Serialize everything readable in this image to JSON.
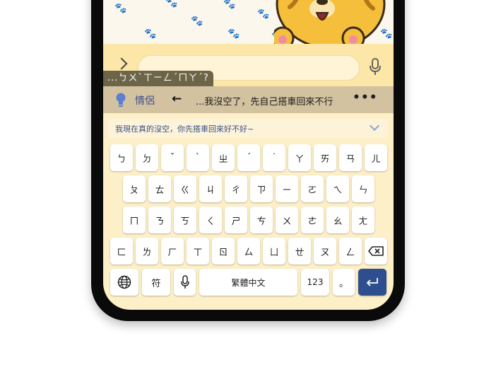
{
  "wallpaper": {
    "paws": [
      "🐾",
      "🐾",
      "🐾",
      "🐾",
      "🐾",
      "🐾",
      "🐾",
      "🐾",
      "🐾"
    ]
  },
  "chatbar": {
    "message_placeholder": ""
  },
  "composing": {
    "text": "...ㄅㄨˋㄒㄧㄥˊㄇㄚˊ?"
  },
  "candidates": {
    "category": "情侶",
    "back_glyph": "←",
    "text": "...我沒空了，先自己搭車回來不行",
    "more_glyph": "•••"
  },
  "suggestion": {
    "text": "我現在真的沒空，你先搭車回來好不好~"
  },
  "keyboard": {
    "row1": [
      "ㄅ",
      "ㄉ",
      "ˇ",
      "ˋ",
      "ㄓ",
      "ˊ",
      "˙",
      "ㄚ",
      "ㄞ",
      "ㄢ",
      "ㄦ"
    ],
    "row2": [
      "ㄆ",
      "ㄊ",
      "ㄍ",
      "ㄐ",
      "ㄔ",
      "ㄗ",
      "ㄧ",
      "ㄛ",
      "ㄟ",
      "ㄣ"
    ],
    "row3": [
      "ㄇ",
      "ㄋ",
      "ㄎ",
      "ㄑ",
      "ㄕ",
      "ㄘ",
      "ㄨ",
      "ㄜ",
      "ㄠ",
      "ㄤ"
    ],
    "row4": [
      "ㄈ",
      "ㄌ",
      "ㄏ",
      "ㄒ",
      "ㄖ",
      "ㄙ",
      "ㄩ",
      "ㄝ",
      "ㄡ",
      "ㄥ"
    ],
    "symbols_label": "符",
    "space_label": "繁體中文",
    "numbers_label": "123",
    "period_label": "。",
    "icons": {
      "globe": "globe-icon",
      "mic": "microphone-icon",
      "backspace": "backspace-icon",
      "enter": "enter-icon"
    }
  },
  "colors": {
    "accent": "#2f4e8f",
    "candidate_bar": "#d3c29f",
    "keyboard_bg": "#fdf0c8",
    "chat_bar": "#fce7a8"
  }
}
